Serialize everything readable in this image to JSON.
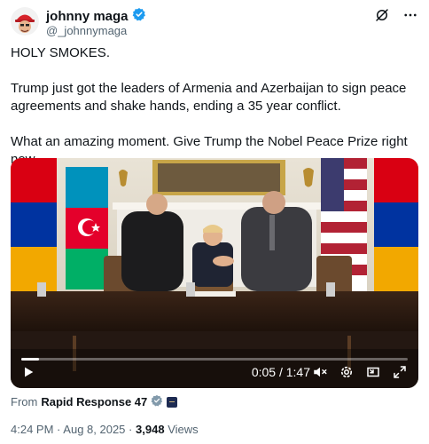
{
  "author": {
    "display_name": "johnny maga",
    "handle": "@_johnnymaga",
    "avatar_icon": "avatar-red-cap-icon",
    "verified_color": "#1d9bf0"
  },
  "header_actions": {
    "grok_icon": "grok-icon",
    "more_icon": "more-dots-icon"
  },
  "tweet": {
    "paragraphs": [
      "HOLY SMOKES.",
      "Trump just got the leaders of Armenia and Azerbaijan to sign peace agreements and shake hands, ending a 35 year conflict.",
      "What an amazing moment. Give Trump the Nobel Peace Prize right now."
    ]
  },
  "video": {
    "current_time": "0:05",
    "separator": " / ",
    "duration": "1:47",
    "progress_fraction": 0.047,
    "icons": [
      "play-icon",
      "mute-icon",
      "settings-icon",
      "pip-icon",
      "fullscreen-icon"
    ]
  },
  "source": {
    "prefix": "From",
    "name": "Rapid Response 47"
  },
  "meta": {
    "time": "4:24 PM",
    "dot": "·",
    "date": "Aug 8, 2025",
    "views_count": "3,948",
    "views_label": "Views"
  },
  "colors": {
    "text_primary": "#0f1419",
    "text_secondary": "#536471",
    "verified": "#1d9bf0"
  }
}
